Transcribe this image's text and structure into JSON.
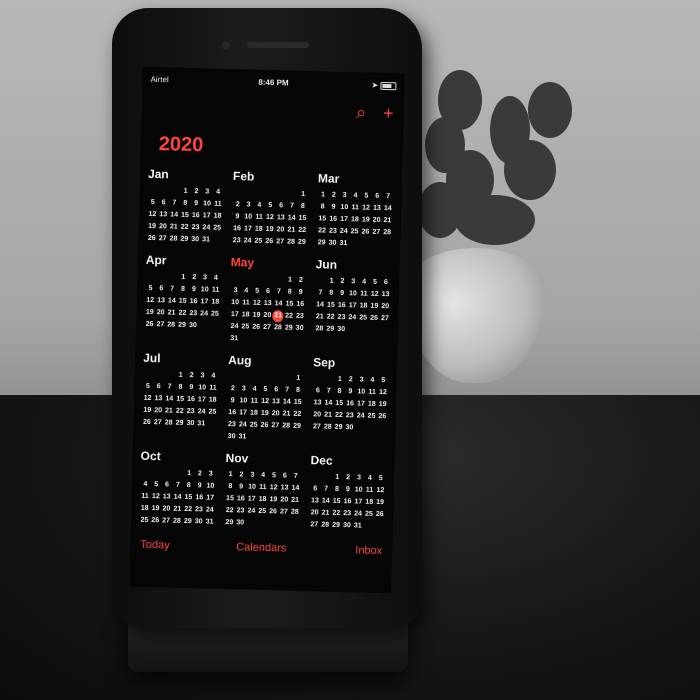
{
  "status_bar": {
    "carrier": "Airtel",
    "time": "8:46 PM"
  },
  "toolbar": {
    "search_icon": "search-icon",
    "add_icon": "plus-icon",
    "accent_color": "#ff453a"
  },
  "year": "2020",
  "current_day": "21",
  "months": [
    {
      "name": "Jan",
      "days": [
        "",
        "",
        "",
        "1",
        "2",
        "3",
        "4",
        "5",
        "6",
        "7",
        "8",
        "9",
        "10",
        "11",
        "12",
        "13",
        "14",
        "15",
        "16",
        "17",
        "18",
        "19",
        "20",
        "21",
        "22",
        "23",
        "24",
        "25",
        "26",
        "27",
        "28",
        "29",
        "30",
        "31"
      ]
    },
    {
      "name": "Feb",
      "days": [
        "",
        "",
        "",
        "",
        "",
        "",
        "1",
        "2",
        "3",
        "4",
        "5",
        "6",
        "7",
        "8",
        "9",
        "10",
        "11",
        "12",
        "13",
        "14",
        "15",
        "16",
        "17",
        "18",
        "19",
        "20",
        "21",
        "22",
        "23",
        "24",
        "25",
        "26",
        "27",
        "28",
        "29"
      ]
    },
    {
      "name": "Mar",
      "days": [
        "1",
        "2",
        "3",
        "4",
        "5",
        "6",
        "7",
        "8",
        "9",
        "10",
        "11",
        "12",
        "13",
        "14",
        "15",
        "16",
        "17",
        "18",
        "19",
        "20",
        "21",
        "22",
        "23",
        "24",
        "25",
        "26",
        "27",
        "28",
        "29",
        "30",
        "31"
      ]
    },
    {
      "name": "Apr",
      "days": [
        "",
        "",
        "",
        "1",
        "2",
        "3",
        "4",
        "5",
        "6",
        "7",
        "8",
        "9",
        "10",
        "11",
        "12",
        "13",
        "14",
        "15",
        "16",
        "17",
        "18",
        "19",
        "20",
        "21",
        "22",
        "23",
        "24",
        "25",
        "26",
        "27",
        "28",
        "29",
        "30"
      ]
    },
    {
      "name": "May",
      "current": true,
      "days": [
        "",
        "",
        "",
        "",
        "",
        "1",
        "2",
        "3",
        "4",
        "5",
        "6",
        "7",
        "8",
        "9",
        "10",
        "11",
        "12",
        "13",
        "14",
        "15",
        "16",
        "17",
        "18",
        "19",
        "20",
        "21",
        "22",
        "23",
        "24",
        "25",
        "26",
        "27",
        "28",
        "29",
        "30",
        "31"
      ]
    },
    {
      "name": "Jun",
      "days": [
        "",
        "1",
        "2",
        "3",
        "4",
        "5",
        "6",
        "7",
        "8",
        "9",
        "10",
        "11",
        "12",
        "13",
        "14",
        "15",
        "16",
        "17",
        "18",
        "19",
        "20",
        "21",
        "22",
        "23",
        "24",
        "25",
        "26",
        "27",
        "28",
        "29",
        "30"
      ]
    },
    {
      "name": "Jul",
      "days": [
        "",
        "",
        "",
        "1",
        "2",
        "3",
        "4",
        "5",
        "6",
        "7",
        "8",
        "9",
        "10",
        "11",
        "12",
        "13",
        "14",
        "15",
        "16",
        "17",
        "18",
        "19",
        "20",
        "21",
        "22",
        "23",
        "24",
        "25",
        "26",
        "27",
        "28",
        "29",
        "30",
        "31"
      ]
    },
    {
      "name": "Aug",
      "days": [
        "",
        "",
        "",
        "",
        "",
        "",
        "1",
        "2",
        "3",
        "4",
        "5",
        "6",
        "7",
        "8",
        "9",
        "10",
        "11",
        "12",
        "13",
        "14",
        "15",
        "16",
        "17",
        "18",
        "19",
        "20",
        "21",
        "22",
        "23",
        "24",
        "25",
        "26",
        "27",
        "28",
        "29",
        "30",
        "31"
      ]
    },
    {
      "name": "Sep",
      "days": [
        "",
        "",
        "1",
        "2",
        "3",
        "4",
        "5",
        "6",
        "7",
        "8",
        "9",
        "10",
        "11",
        "12",
        "13",
        "14",
        "15",
        "16",
        "17",
        "18",
        "19",
        "20",
        "21",
        "22",
        "23",
        "24",
        "25",
        "26",
        "27",
        "28",
        "29",
        "30"
      ]
    },
    {
      "name": "Oct",
      "days": [
        "",
        "",
        "",
        "",
        "1",
        "2",
        "3",
        "4",
        "5",
        "6",
        "7",
        "8",
        "9",
        "10",
        "11",
        "12",
        "13",
        "14",
        "15",
        "16",
        "17",
        "18",
        "19",
        "20",
        "21",
        "22",
        "23",
        "24",
        "25",
        "26",
        "27",
        "28",
        "29",
        "30",
        "31"
      ]
    },
    {
      "name": "Nov",
      "days": [
        "1",
        "2",
        "3",
        "4",
        "5",
        "6",
        "7",
        "8",
        "9",
        "10",
        "11",
        "12",
        "13",
        "14",
        "15",
        "16",
        "17",
        "18",
        "19",
        "20",
        "21",
        "22",
        "23",
        "24",
        "25",
        "26",
        "27",
        "28",
        "29",
        "30"
      ]
    },
    {
      "name": "Dec",
      "days": [
        "",
        "",
        "1",
        "2",
        "3",
        "4",
        "5",
        "6",
        "7",
        "8",
        "9",
        "10",
        "11",
        "12",
        "13",
        "14",
        "15",
        "16",
        "17",
        "18",
        "19",
        "20",
        "21",
        "22",
        "23",
        "24",
        "25",
        "26",
        "27",
        "28",
        "29",
        "30",
        "31"
      ]
    }
  ],
  "tabbar": {
    "today": "Today",
    "calendars": "Calendars",
    "inbox": "Inbox"
  }
}
